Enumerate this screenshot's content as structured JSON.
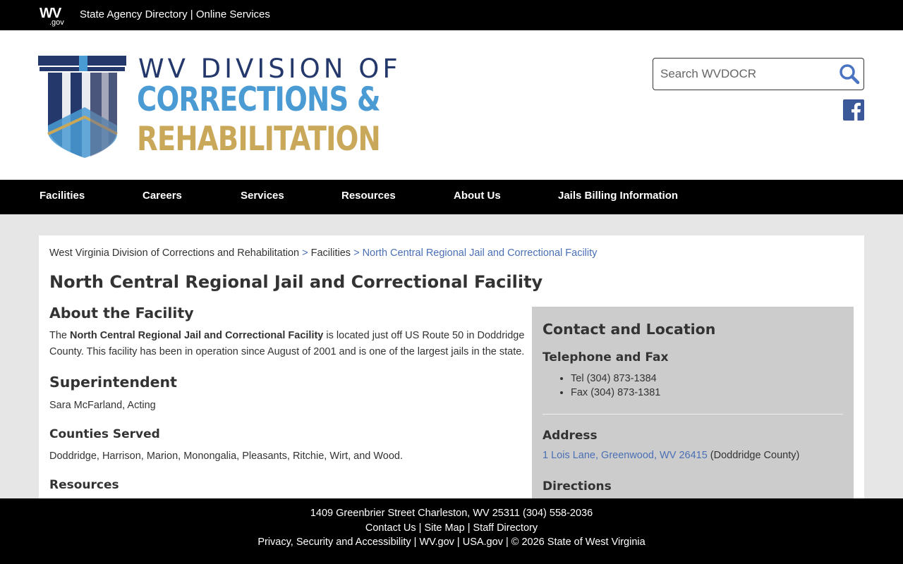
{
  "topbar": {
    "logo_wv": "WV",
    "logo_gov": ".gov",
    "agency_directory": "State Agency Directory",
    "separator": "|",
    "online_services": "Online Services"
  },
  "header": {
    "logo_line1": "WV DIVISION OF",
    "logo_line2": "CORRECTIONS &",
    "logo_line3": "REHABILITATION",
    "search_placeholder": "Search WVDOCR",
    "colors": {
      "navy": "#24386b",
      "blue": "#4a9bd4",
      "gold": "#c9a85a",
      "facebook": "#3b5998"
    }
  },
  "nav": {
    "items": [
      "Facilities",
      "Careers",
      "Services",
      "Resources",
      "About Us",
      "Jails Billing Information"
    ]
  },
  "breadcrumb": {
    "home": "West Virginia Division of Corrections and Rehabilitation",
    "sep": ">",
    "facilities": "Facilities",
    "current": "North Central Regional Jail and Correctional Facility"
  },
  "page": {
    "title": "North Central Regional Jail and Correctional Facility",
    "about_heading": "About the Facility",
    "about_pre": "The ",
    "about_bold": "North Central Regional Jail and Correctional Facility",
    "about_post": " is located just off US Route 50 in Doddridge County. This facility has been in operation since August of 2001 and is one of the largest jails in the state.",
    "superintendent_heading": "Superintendent",
    "superintendent_name": "Sara McFarland, Acting",
    "counties_heading": "Counties Served",
    "counties": "Doddridge, Harrison, Marion, Monongalia, Pleasants, Ritchie, Wirt, and Wood.",
    "resources_heading": "Resources"
  },
  "contact": {
    "heading": "Contact and Location",
    "phone_heading": "Telephone and Fax",
    "tel": "Tel (304) 873-1384",
    "fax": "Fax (304) 873-1381",
    "address_heading": "Address",
    "address_link": "1 Lois Lane, Greenwood, WV 26415",
    "address_county": " (Doddridge County)",
    "directions_heading": "Directions"
  },
  "footer": {
    "address": "1409 Greenbrier Street Charleston, WV 25311 (304) 558-2036",
    "contact_us": "Contact Us",
    "site_map": "Site Map",
    "staff_directory": "Staff Directory",
    "privacy": "Privacy, Security and Accessibility",
    "wvgov": "WV.gov",
    "usagov": "USA.gov",
    "copyright": "© 2026 State of West Virginia",
    "sep": " | "
  }
}
